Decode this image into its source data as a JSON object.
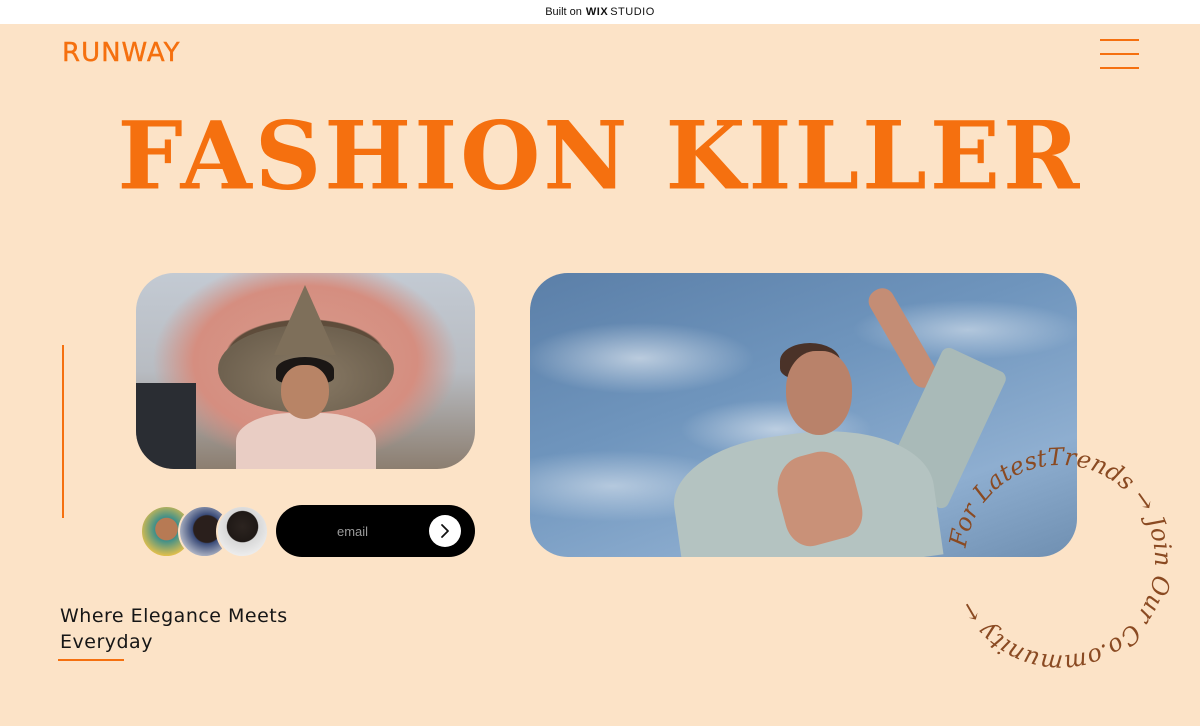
{
  "wix_banner": {
    "prefix": "Built on",
    "brand": "WIX",
    "suffix": "STUDIO"
  },
  "header": {
    "logo": "RUNWAY",
    "menu_icon": "hamburger-menu-icon"
  },
  "hero": {
    "title": "FASHION KILLER"
  },
  "images": {
    "left_photo": "child-with-straw-hat-and-pink-feathers",
    "right_photo": "woman-in-light-blue-coat-against-cloudy-sky"
  },
  "community": {
    "avatars": [
      "avatar-1",
      "avatar-2",
      "avatar-3"
    ],
    "email_placeholder": "email",
    "submit_icon": "chevron-right-icon"
  },
  "tagline": {
    "line1": "Where Elegance Meets",
    "line2": "Everyday"
  },
  "circular_text": {
    "text": "For LatestTrends → Join Our Co.ommunity ←"
  },
  "colors": {
    "accent": "#f5700f",
    "background": "#fce3c7",
    "circle_text": "#8a4a22"
  }
}
